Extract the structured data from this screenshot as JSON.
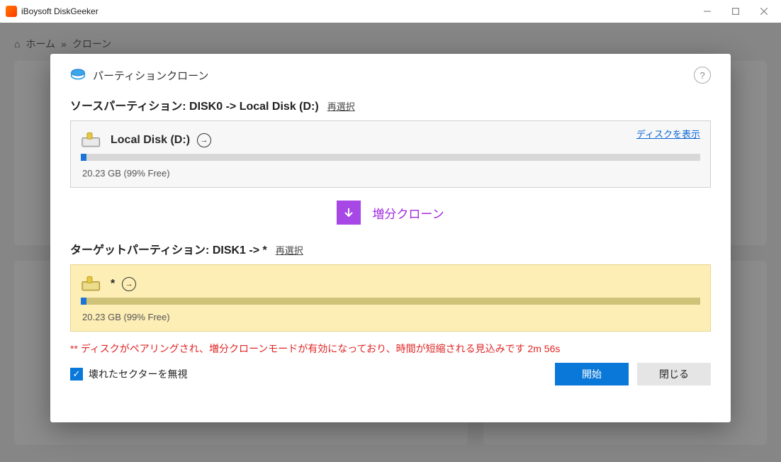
{
  "app": {
    "title": "iBoysoft DiskGeeker"
  },
  "breadcrumb": {
    "home": "ホーム",
    "sep": "»",
    "current": "クローン"
  },
  "dialog": {
    "title": "パーティションクローン",
    "sourceLabel": "ソースパーティション: DISK0 -> Local Disk (D:)",
    "reselect": "再選択",
    "showDisk": "ディスクを表示",
    "source": {
      "name": "Local Disk (D:)",
      "stat": "20.23 GB (99% Free)"
    },
    "mode": "増分クローン",
    "targetLabel": "ターゲットパーティション: DISK1 -> *",
    "target": {
      "name": "*",
      "stat": "20.23 GB (99% Free)"
    },
    "note": "** ディスクがペアリングされ、増分クローンモードが有効になっており、時間が短縮される見込みです 2m 56s",
    "ignoreBad": "壊れたセクターを無視",
    "start": "開始",
    "close": "閉じる"
  }
}
